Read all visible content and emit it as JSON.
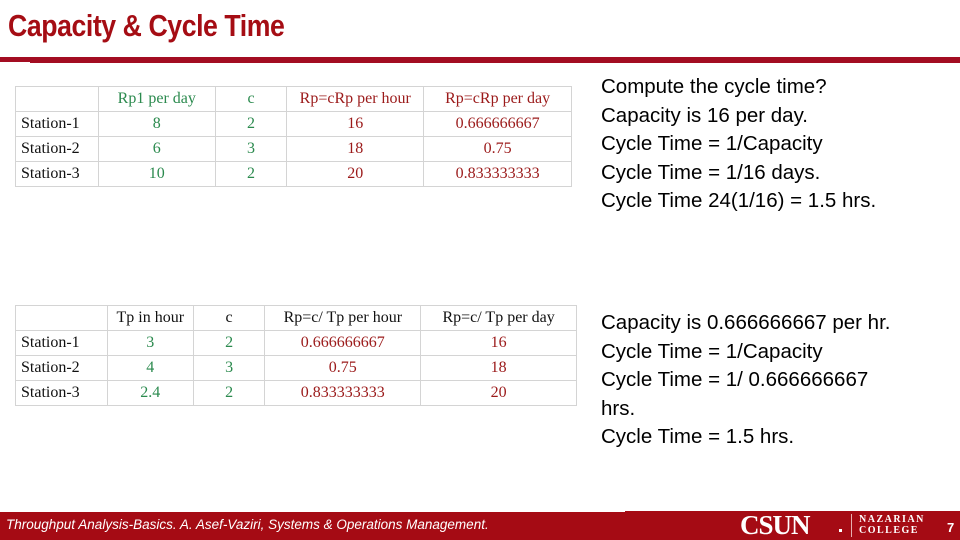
{
  "slide": {
    "title": "Capacity & Cycle Time",
    "footer_text": "Throughput Analysis-Basics. A. Asef-Vaziri, Systems & Operations Management.",
    "logo_text": "CSUN",
    "college_line1": "NAZARIAN",
    "college_line2": "COLLEGE",
    "page_number": "7"
  },
  "table1": {
    "headers": [
      "",
      "Rp1 per  day",
      "c",
      "Rp=cRp per hour",
      "Rp=cRp per day"
    ],
    "rows": [
      {
        "label": "Station-1",
        "cells": [
          "8",
          "2",
          "16",
          "0.666666667"
        ]
      },
      {
        "label": "Station-2",
        "cells": [
          "6",
          "3",
          "18",
          "0.75"
        ]
      },
      {
        "label": "Station-3",
        "cells": [
          "10",
          "2",
          "20",
          "0.833333333"
        ]
      }
    ]
  },
  "table2": {
    "headers": [
      "",
      "Tp in hour",
      "c",
      "Rp=c/ Tp per hour",
      "Rp=c/ Tp per day"
    ],
    "rows": [
      {
        "label": "Station-1",
        "cells": [
          "3",
          "2",
          "0.666666667",
          "16"
        ]
      },
      {
        "label": "Station-2",
        "cells": [
          "4",
          "3",
          "0.75",
          "18"
        ]
      },
      {
        "label": "Station-3",
        "cells": [
          "2.4",
          "2",
          "0.833333333",
          "20"
        ]
      }
    ]
  },
  "notes1": [
    "Compute the cycle time?",
    "Capacity is 16 per day.",
    "Cycle Time = 1/Capacity",
    "Cycle Time = 1/16 days.",
    "Cycle Time 24(1/16) = 1.5  hrs."
  ],
  "notes2": [
    "Capacity is 0.666666667 per hr.",
    "Cycle Time = 1/Capacity",
    "Cycle Time = 1/ 0.666666667",
    "hrs.",
    "Cycle Time = 1.5 hrs."
  ],
  "colors": {
    "brand_red": "#a50b14",
    "input_green": "#2b8a4e",
    "output_red": "#9b1a1a"
  }
}
